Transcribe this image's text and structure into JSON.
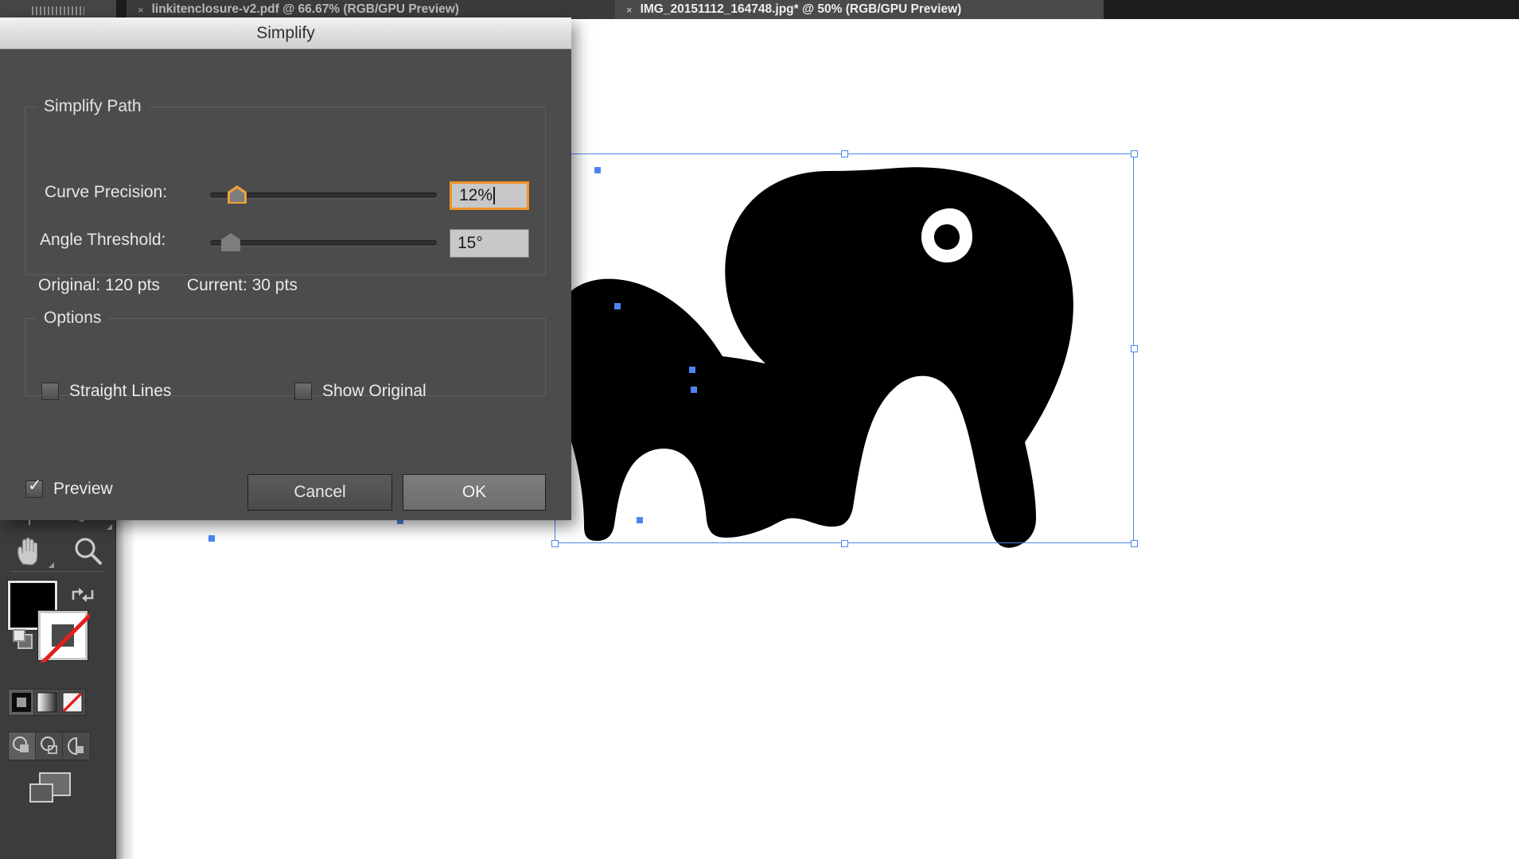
{
  "window": {
    "tabs": [
      {
        "title": "linkitenclosure-v2.pdf @ 66.67% (RGB/GPU Preview)",
        "close": "×",
        "active": false
      },
      {
        "title": "IMG_20151112_164748.jpg* @ 50% (RGB/GPU Preview)",
        "close": "×",
        "active": true
      }
    ]
  },
  "dialog": {
    "title": "Simplify",
    "groups": {
      "simplify_path": {
        "legend": "Simplify Path",
        "curve_precision": {
          "label": "Curve Precision:",
          "value": "12%",
          "slider_percent": 12
        },
        "angle_threshold": {
          "label": "Angle Threshold:",
          "value": "15°",
          "slider_percent": 8
        },
        "points": {
          "original": "Original: 120 pts",
          "current": "Current: 30 pts"
        }
      },
      "options": {
        "legend": "Options",
        "straight_lines": {
          "label": "Straight Lines",
          "checked": false
        },
        "show_original": {
          "label": "Show Original",
          "checked": false
        }
      }
    },
    "footer": {
      "preview": {
        "label": "Preview",
        "checked": true
      },
      "cancel_label": "Cancel",
      "ok_label": "OK"
    }
  },
  "toolbar": {
    "tools": [
      {
        "name": "artboard-tool"
      },
      {
        "name": "slice-tool"
      },
      {
        "name": "hand-tool"
      },
      {
        "name": "zoom-tool"
      }
    ],
    "fill_color": "#000000",
    "stroke_color": "#ffffff",
    "stroke_none": true,
    "paint_modes": [
      "color",
      "gradient",
      "none"
    ],
    "drawing_modes": [
      "draw-normal",
      "draw-behind",
      "draw-inside"
    ],
    "screen_mode": "change-screen-mode"
  },
  "colors": {
    "dialog_bg": "#4c4c4c",
    "accent_orange": "#f0932b",
    "selection_blue": "#4b86f0",
    "panel_bg": "#3c3c3c",
    "tab_active_bg": "#4a4a4a"
  },
  "artwork": {
    "name": "elephant-silhouette",
    "selected": true,
    "fill": "#000000"
  }
}
